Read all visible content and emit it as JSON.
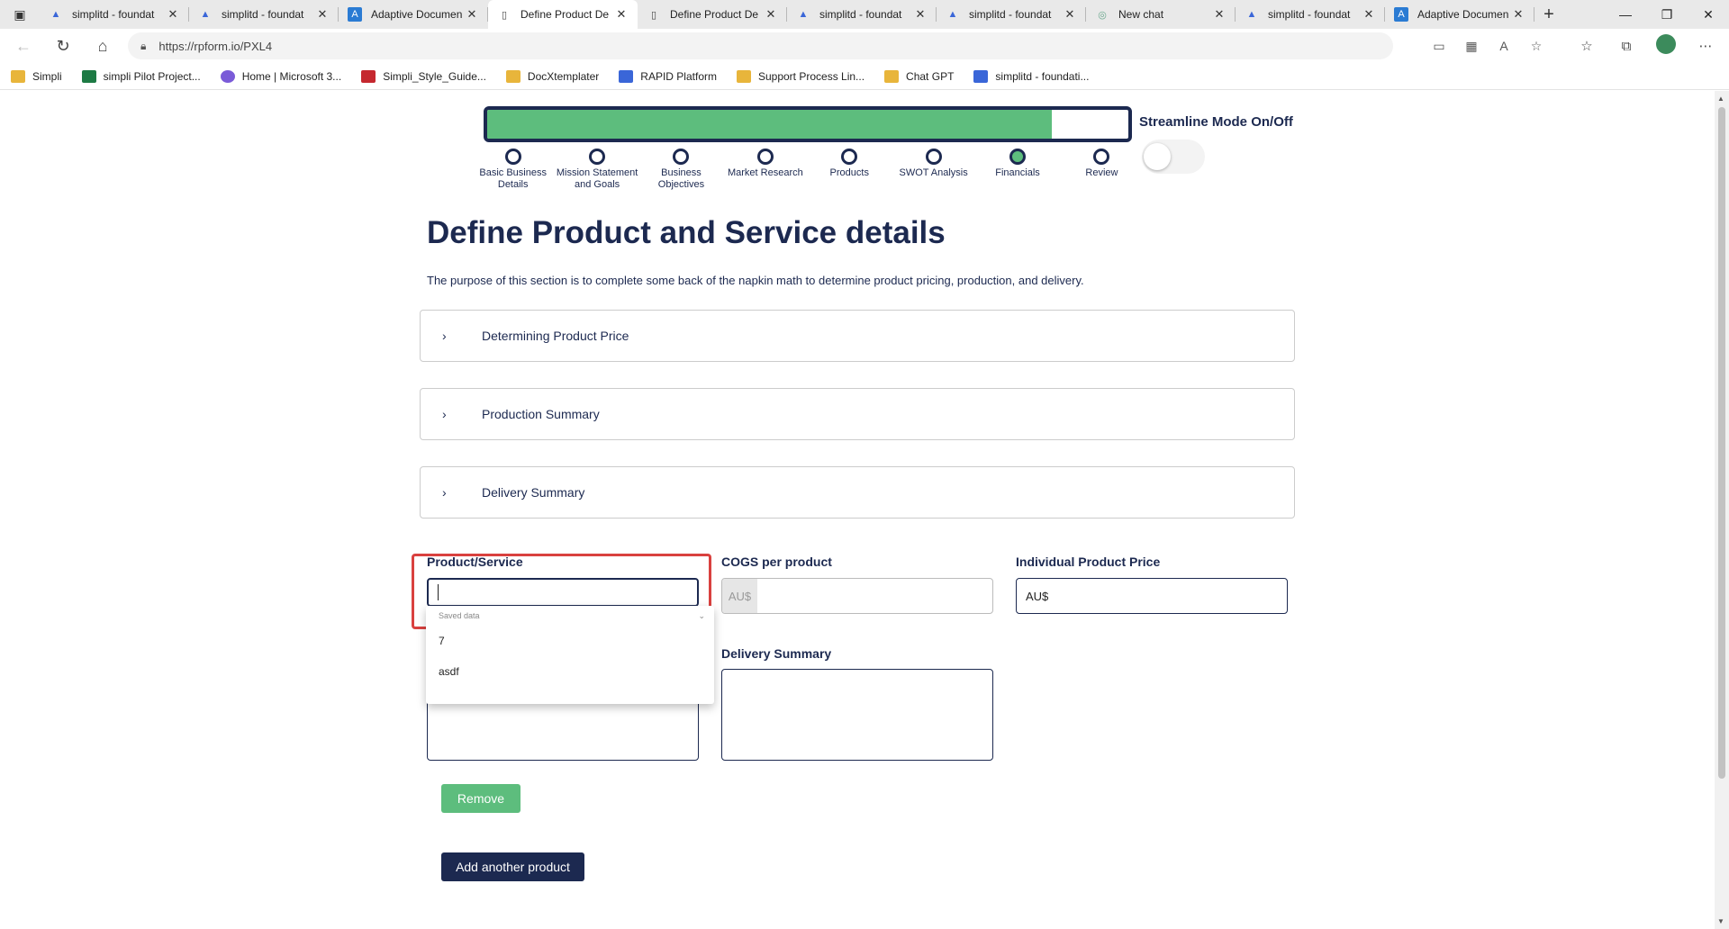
{
  "browser": {
    "tabs": [
      {
        "title": "simplitd - foundat",
        "icon": "azure-icon",
        "active": false
      },
      {
        "title": "simplitd - foundat",
        "icon": "azure-icon",
        "active": false
      },
      {
        "title": "Adaptive Documen",
        "icon": "adaptive-icon",
        "active": false
      },
      {
        "title": "Define Product De",
        "icon": "page-icon",
        "active": true
      },
      {
        "title": "Define Product De",
        "icon": "page-icon",
        "active": false
      },
      {
        "title": "simplitd - foundat",
        "icon": "azure-icon",
        "active": false
      },
      {
        "title": "simplitd - foundat",
        "icon": "azure-icon",
        "active": false
      },
      {
        "title": "New chat",
        "icon": "chatgpt-icon",
        "active": false
      },
      {
        "title": "simplitd - foundat",
        "icon": "azure-icon",
        "active": false
      },
      {
        "title": "Adaptive Documen",
        "icon": "adaptive-icon",
        "active": false
      }
    ],
    "url": "https://rpform.io/PXL4",
    "bookmarks": [
      {
        "label": "Simpli",
        "icon": "folder-icon"
      },
      {
        "label": "simpli Pilot Project...",
        "icon": "excel-icon"
      },
      {
        "label": "Home | Microsoft 3...",
        "icon": "m365-icon"
      },
      {
        "label": "Simpli_Style_Guide...",
        "icon": "pdf-icon"
      },
      {
        "label": "DocXtemplater",
        "icon": "folder-icon"
      },
      {
        "label": "RAPID Platform",
        "icon": "azure-icon"
      },
      {
        "label": "Support Process Lin...",
        "icon": "folder-icon"
      },
      {
        "label": "Chat GPT",
        "icon": "folder-icon"
      },
      {
        "label": "simplitd - foundati...",
        "icon": "azure-icon"
      }
    ]
  },
  "progress": {
    "fill_fraction": 0.88
  },
  "steps": [
    {
      "label": "Basic Business Details",
      "done": false
    },
    {
      "label": "Mission Statement and Goals",
      "done": false
    },
    {
      "label": "Business Objectives",
      "done": false
    },
    {
      "label": "Market Research",
      "done": false
    },
    {
      "label": "Products",
      "done": false
    },
    {
      "label": "SWOT Analysis",
      "done": false
    },
    {
      "label": "Financials",
      "done": true
    },
    {
      "label": "Review",
      "done": false
    }
  ],
  "streamline": {
    "label": "Streamline Mode On/Off",
    "on": false
  },
  "page": {
    "title": "Define Product and Service details",
    "description": "The purpose of this section is to complete some back of the napkin math to determine product pricing, production, and delivery."
  },
  "accordions": [
    {
      "label": "Determining Product Price"
    },
    {
      "label": "Production Summary"
    },
    {
      "label": "Delivery Summary"
    }
  ],
  "form": {
    "product_label": "Product/Service",
    "product_value": "",
    "cogs_label": "COGS per product",
    "cogs_prefix": "AU$",
    "price_label": "Individual Product Price",
    "price_value": "AU$",
    "delivery_label": "Delivery Summary",
    "dropdown_header": "Saved data",
    "dropdown_items": [
      "7",
      "asdf"
    ],
    "remove_label": "Remove",
    "add_label": "Add another product"
  },
  "colors": {
    "navy": "#1c2950",
    "green": "#5dbd7d",
    "highlight": "#d9413f"
  }
}
